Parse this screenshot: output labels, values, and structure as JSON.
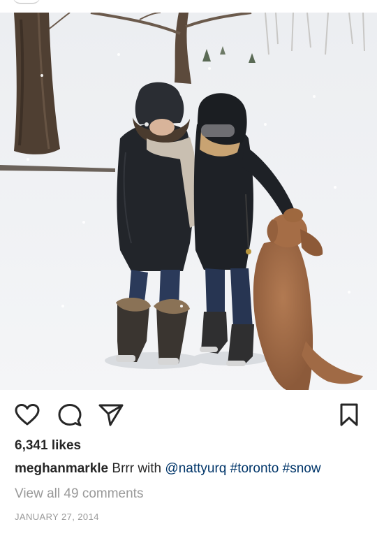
{
  "post": {
    "likes": "6,341 likes",
    "caption": {
      "username": "meghanmarkle",
      "text": " Brrr with ",
      "mention": "@nattyurq",
      "space": " ",
      "hashtags": [
        "#toronto",
        "#snow"
      ]
    },
    "comments_link": "View all 49 comments",
    "date": "JANUARY 27, 2014"
  },
  "actions": {
    "icons": [
      "heart-icon",
      "comment-icon",
      "share-icon",
      "bookmark-icon"
    ]
  },
  "colors": {
    "text": "#262626",
    "muted": "#999999",
    "link": "#003569",
    "background": "#ffffff"
  }
}
